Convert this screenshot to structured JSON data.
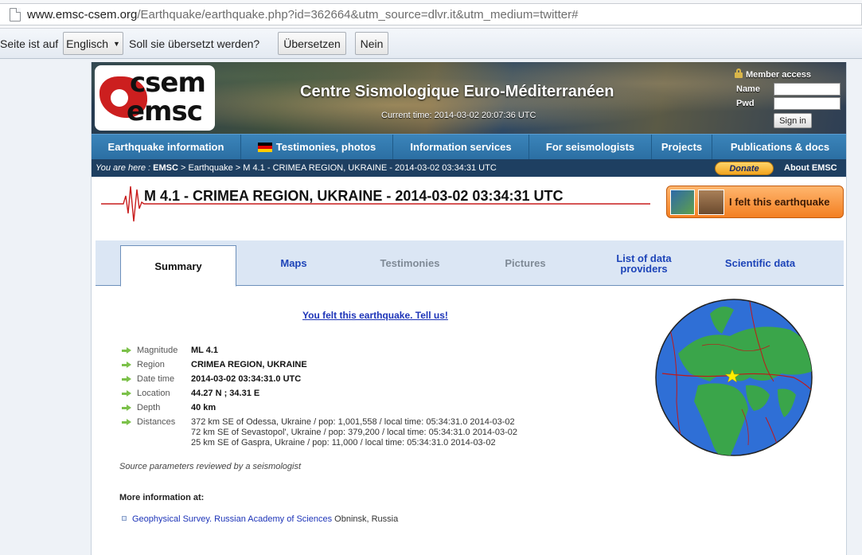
{
  "browser": {
    "url_host": "www.emsc-csem.org",
    "url_path": "/Earthquake/earthquake.php?id=362664&utm_source=dlvr.it&utm_medium=twitter#"
  },
  "translate_bar": {
    "text_start": "Seite ist auf",
    "language": "Englisch",
    "question": "Soll sie übersetzt werden?",
    "translate_label": "Übersetzen",
    "no_label": "Nein"
  },
  "header": {
    "logo_top": "csem",
    "logo_bottom": "emsc",
    "site_title": "Centre Sismologique Euro-Méditerranéen",
    "current_time": "Current time: 2014-03-02 20:07:36 UTC",
    "member_access": "Member access",
    "name_label": "Name",
    "pwd_label": "Pwd",
    "signin_label": "Sign in"
  },
  "nav": {
    "items": [
      "Earthquake information",
      "Testimonies, photos",
      "Information services",
      "For seismologists",
      "Projects",
      "Publications & docs"
    ]
  },
  "breadcrumb": {
    "prefix": "You are here :",
    "root": "EMSC",
    "trail": " > Earthquake > M 4.1 - CRIMEA REGION, UKRAINE - 2014-03-02 03:34:31 UTC",
    "donate_label": "Donate",
    "about_label": "About EMSC"
  },
  "event": {
    "title": "M 4.1 - CRIMEA REGION, UKRAINE - 2014-03-02 03:34:31 UTC",
    "felt_label": "I felt this earthquake"
  },
  "tabs": [
    "Summary",
    "Maps",
    "Testimonies",
    "Pictures",
    "List of data providers",
    "Scientific data"
  ],
  "summary": {
    "tell_us": "You felt this earthquake. Tell us!",
    "params": [
      {
        "label": "Magnitude",
        "value": "ML 4.1"
      },
      {
        "label": "Region",
        "value": "CRIMEA REGION, UKRAINE"
      },
      {
        "label": "Date time",
        "value": "2014-03-02 03:34:31.0 UTC"
      },
      {
        "label": "Location",
        "value": "44.27 N ; 34.31 E"
      },
      {
        "label": "Depth",
        "value": "40 km"
      }
    ],
    "distances_label": "Distances",
    "distances": [
      "372 km SE of Odessa, Ukraine / pop: 1,001,558 / local time: 05:34:31.0 2014-03-02",
      "72 km SE of Sevastopol', Ukraine / pop: 379,200 / local time: 05:34:31.0 2014-03-02",
      "25 km SE of Gaspra, Ukraine / pop: 11,000 / local time: 05:34:31.0 2014-03-02"
    ],
    "reviewed": "Source parameters reviewed by a seismologist",
    "more_info": "More information at:",
    "agency_name": "Geophysical Survey. Russian Academy of Sciences",
    "agency_city": " Obninsk, Russia"
  },
  "colors": {
    "nav_blue": "#2b6fa3",
    "crumb_navy": "#1e3f61",
    "felt_orange": "#f37f22",
    "link_blue": "#1d34b8",
    "arrow_green": "#7cc14a",
    "epicenter_yellow": "#ffee00"
  }
}
